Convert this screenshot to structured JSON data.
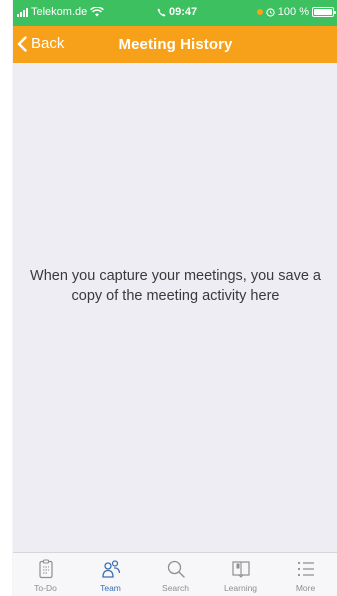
{
  "status_bar": {
    "carrier": "Telekom.de",
    "time": "09:47",
    "battery": "100 %",
    "battery_level": 1.0
  },
  "nav": {
    "back_label": "Back",
    "title": "Meeting History"
  },
  "content": {
    "empty_message": "When you capture your meetings, you save a copy of the meeting activity here"
  },
  "tabs": [
    {
      "label": "To-Do",
      "icon": "clipboard-icon",
      "active": false
    },
    {
      "label": "Team",
      "icon": "team-icon",
      "active": true
    },
    {
      "label": "Search",
      "icon": "search-icon",
      "active": false
    },
    {
      "label": "Learning",
      "icon": "book-icon",
      "active": false
    },
    {
      "label": "More",
      "icon": "menu-icon",
      "active": false
    }
  ],
  "colors": {
    "status_bar": "#3cc060",
    "nav_bar": "#f7a11a",
    "background": "#eeedf3",
    "tab_active": "#3a6fb0",
    "tab_inactive": "#8e8e93"
  }
}
